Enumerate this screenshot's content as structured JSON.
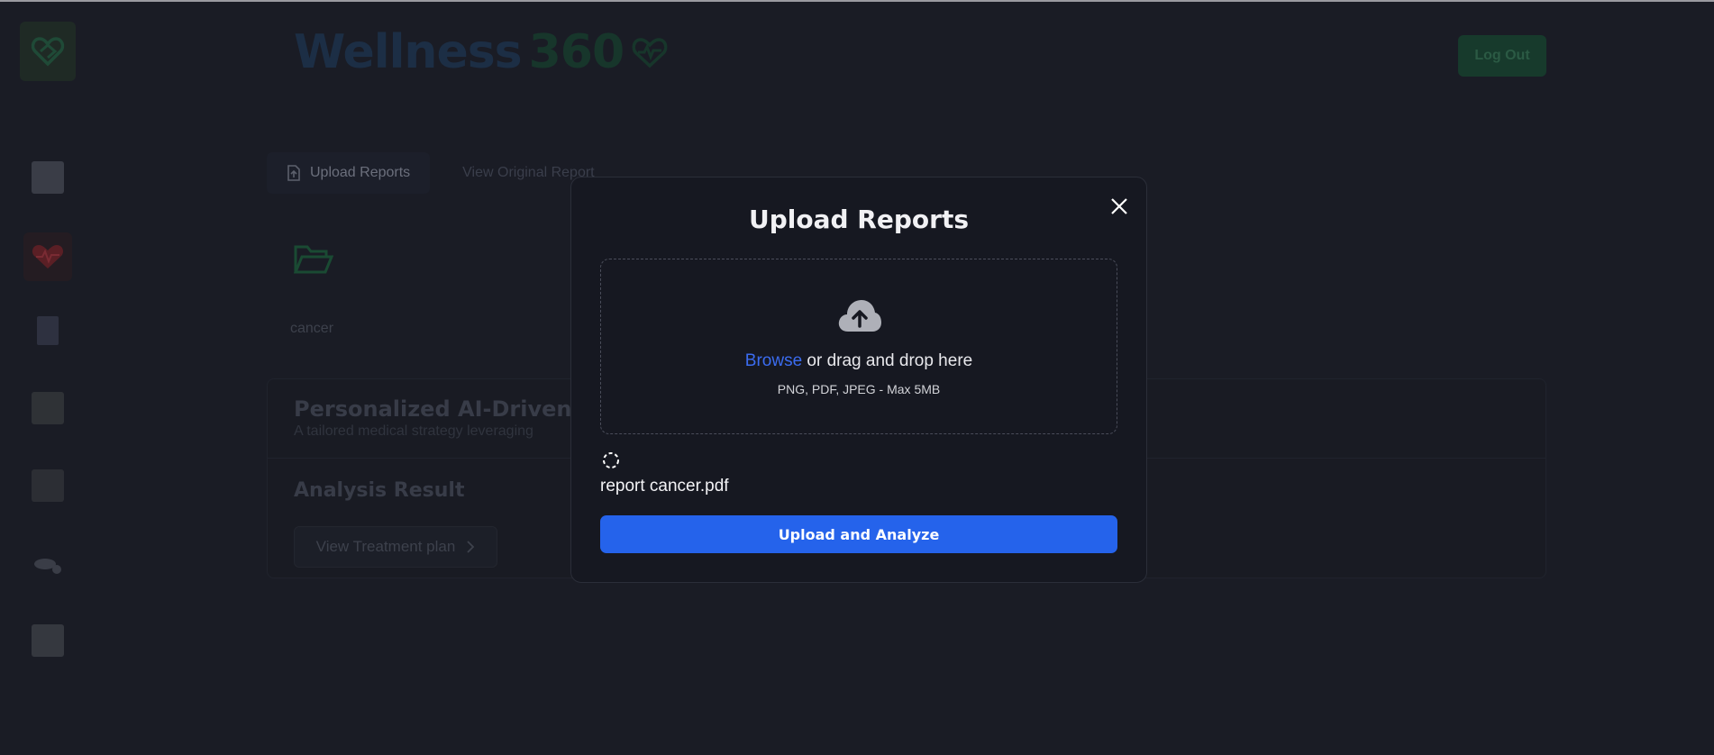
{
  "app": {
    "title_word": "Wellness",
    "title_number": "360",
    "logout_label": "Log Out"
  },
  "tabs": [
    {
      "label": "Upload Reports",
      "active": true
    },
    {
      "label": "View Original Report",
      "active": false
    }
  ],
  "upload_section": {
    "file_label": "cancer"
  },
  "ai_section": {
    "title": "Personalized AI-Driven Trea",
    "subtitle": "A tailored medical strategy leveraging"
  },
  "analysis": {
    "title": "Analysis Result",
    "treatment_button_label": "View Treatment plan"
  },
  "modal": {
    "title": "Upload Reports",
    "browse_label": "Browse",
    "drop_text": " or drag and drop here",
    "hint": "PNG, PDF, JPEG - Max 5MB",
    "file_name": "report cancer.pdf",
    "submit_label": "Upload and Analyze"
  },
  "colors": {
    "brand_green": "#1b3a2e",
    "accent_blue": "#2563eb",
    "background": "#1a1c25"
  }
}
